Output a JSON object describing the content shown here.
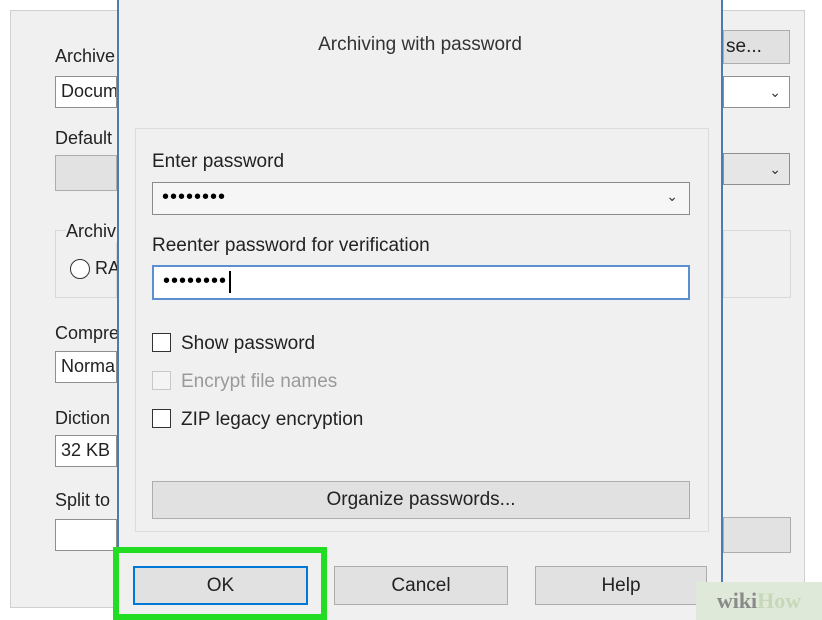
{
  "background_dialog": {
    "archive_name_label": "Archive",
    "archive_name_value": "Docum",
    "browse_button_label": "se...",
    "default_profile_label": "Default",
    "archive_format_label": "Archiv",
    "format_rar_label": "RA",
    "compression_label": "Compre",
    "compression_value": "Norma",
    "dictionary_label": "Diction",
    "dictionary_value": "32 KB",
    "split_label": "Split to"
  },
  "password_dialog": {
    "title": "Archiving with password",
    "enter_password_label": "Enter password",
    "enter_password_value": "••••••••",
    "reenter_password_label": "Reenter password for verification",
    "reenter_password_value": "••••••••",
    "checkboxes": [
      {
        "label": "Show password",
        "checked": false,
        "enabled": true
      },
      {
        "label": "Encrypt file names",
        "checked": false,
        "enabled": false
      },
      {
        "label": "ZIP legacy encryption",
        "checked": false,
        "enabled": true
      }
    ],
    "organize_button_label": "Organize passwords...",
    "buttons": {
      "ok": "OK",
      "cancel": "Cancel",
      "help": "Help"
    }
  },
  "highlight_color": "#22dd22",
  "watermark": {
    "part1": "wiki",
    "part2": "How"
  }
}
